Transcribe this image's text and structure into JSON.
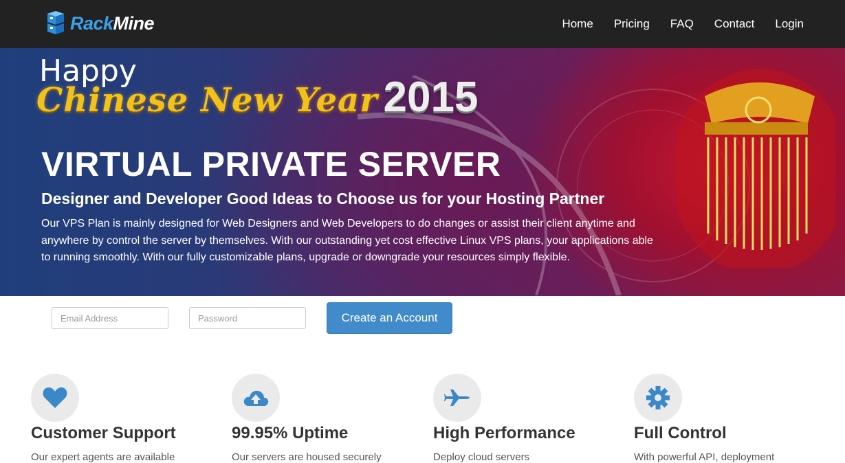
{
  "brand": {
    "name_part1": "Rack",
    "name_part2": "Mine"
  },
  "nav": {
    "items": [
      "Home",
      "Pricing",
      "FAQ",
      "Contact",
      "Login"
    ]
  },
  "hero": {
    "happy": "Happy",
    "cny": "Chinese New Year",
    "year": "2015",
    "title": "VIRTUAL PRIVATE SERVER",
    "subtitle": "Designer and Developer Good Ideas to Choose us for your Hosting Partner",
    "description": "Our VPS Plan is mainly designed for Web Designers and Web Developers to do changes or assist their client anytime and anywhere by control the server by themselves. With our outstanding yet cost effective Linux VPS plans, your applications able to running smoothly. With our fully customizable plans, upgrade or downgrade your resources simply flexible."
  },
  "signup": {
    "email_placeholder": "Email Address",
    "password_placeholder": "Password",
    "button_label": "Create an Account"
  },
  "features": [
    {
      "title": "Customer Support",
      "icon": "heart-icon",
      "text": "Our expert agents are available"
    },
    {
      "title": "99.95% Uptime",
      "icon": "cloud-upload-icon",
      "text": "Our servers are housed securely"
    },
    {
      "title": "High Performance",
      "icon": "fighter-jet-icon",
      "text": "Deploy cloud servers"
    },
    {
      "title": "Full Control",
      "icon": "gear-icon",
      "text": "With powerful API, deployment"
    }
  ],
  "colors": {
    "accent": "#428bca",
    "navbar": "#222222",
    "logo_blue": "#3aa0e8",
    "icon_blue": "#3b88c9"
  }
}
